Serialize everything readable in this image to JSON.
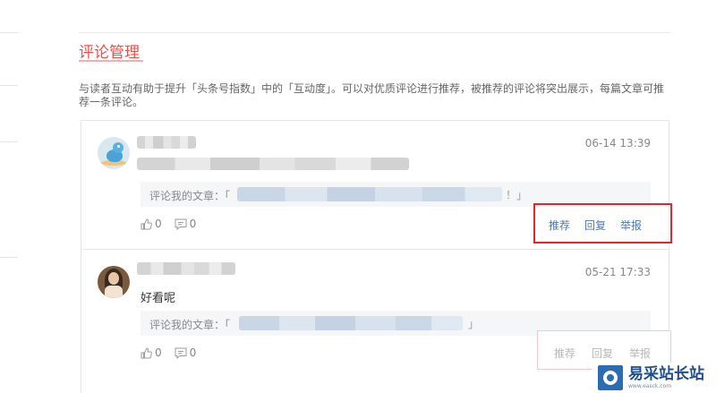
{
  "page": {
    "title": "评论管理",
    "description": "与读者互动有助于提升「头条号指数」中的「互动度」。可以对优质评论进行推荐，被推荐的评论将突出展示，每篇文章可推荐一条评论。"
  },
  "comments": [
    {
      "time": "06-14 13:39",
      "content": "",
      "quote_label": "评论我的文章：「",
      "quote_close": "！」",
      "likes": "0",
      "replies": "0",
      "actions": [
        "推荐",
        "回复",
        "举报"
      ]
    },
    {
      "time": "05-21 17:33",
      "content": "好看呢",
      "quote_label": "评论我的文章：「",
      "quote_close": "」",
      "likes": "0",
      "replies": "0",
      "actions": [
        "推荐",
        "回复",
        "举报"
      ]
    }
  ],
  "watermark": {
    "name": "易采站长站",
    "url": "www.easck.com"
  },
  "colors": {
    "accent": "#e8514b",
    "link": "#4a78b3",
    "highlight_box": "#e2262e"
  },
  "icons": {
    "like": "thumb-up-icon",
    "reply": "comment-icon"
  }
}
